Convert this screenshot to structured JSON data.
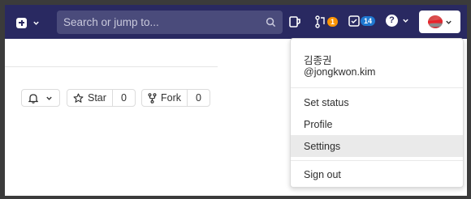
{
  "navbar": {
    "background": "#292961",
    "new_dropdown_icon": "plus-square-icon",
    "search": {
      "placeholder": "Search or jump to..."
    },
    "todo_icon": "issues-icon",
    "merge_requests": {
      "icon": "merge-request-icon",
      "count": "1",
      "badge_color": "#fc9403"
    },
    "todos": {
      "icon": "todo-check-icon",
      "count": "14",
      "badge_color": "#1f78d1"
    },
    "help": {
      "icon": "question-icon",
      "glyph": "?"
    },
    "avatar_icon": "user-avatar"
  },
  "repo_actions": {
    "notifications_icon": "bell-icon",
    "star": {
      "label": "Star",
      "count": "0"
    },
    "fork": {
      "label": "Fork",
      "count": "0"
    }
  },
  "user_menu": {
    "name": "김종권",
    "handle": "@jongkwon.kim",
    "items": [
      {
        "label": "Set status"
      },
      {
        "label": "Profile"
      },
      {
        "label": "Settings",
        "active": true
      },
      {
        "label": "Sign out"
      }
    ]
  }
}
